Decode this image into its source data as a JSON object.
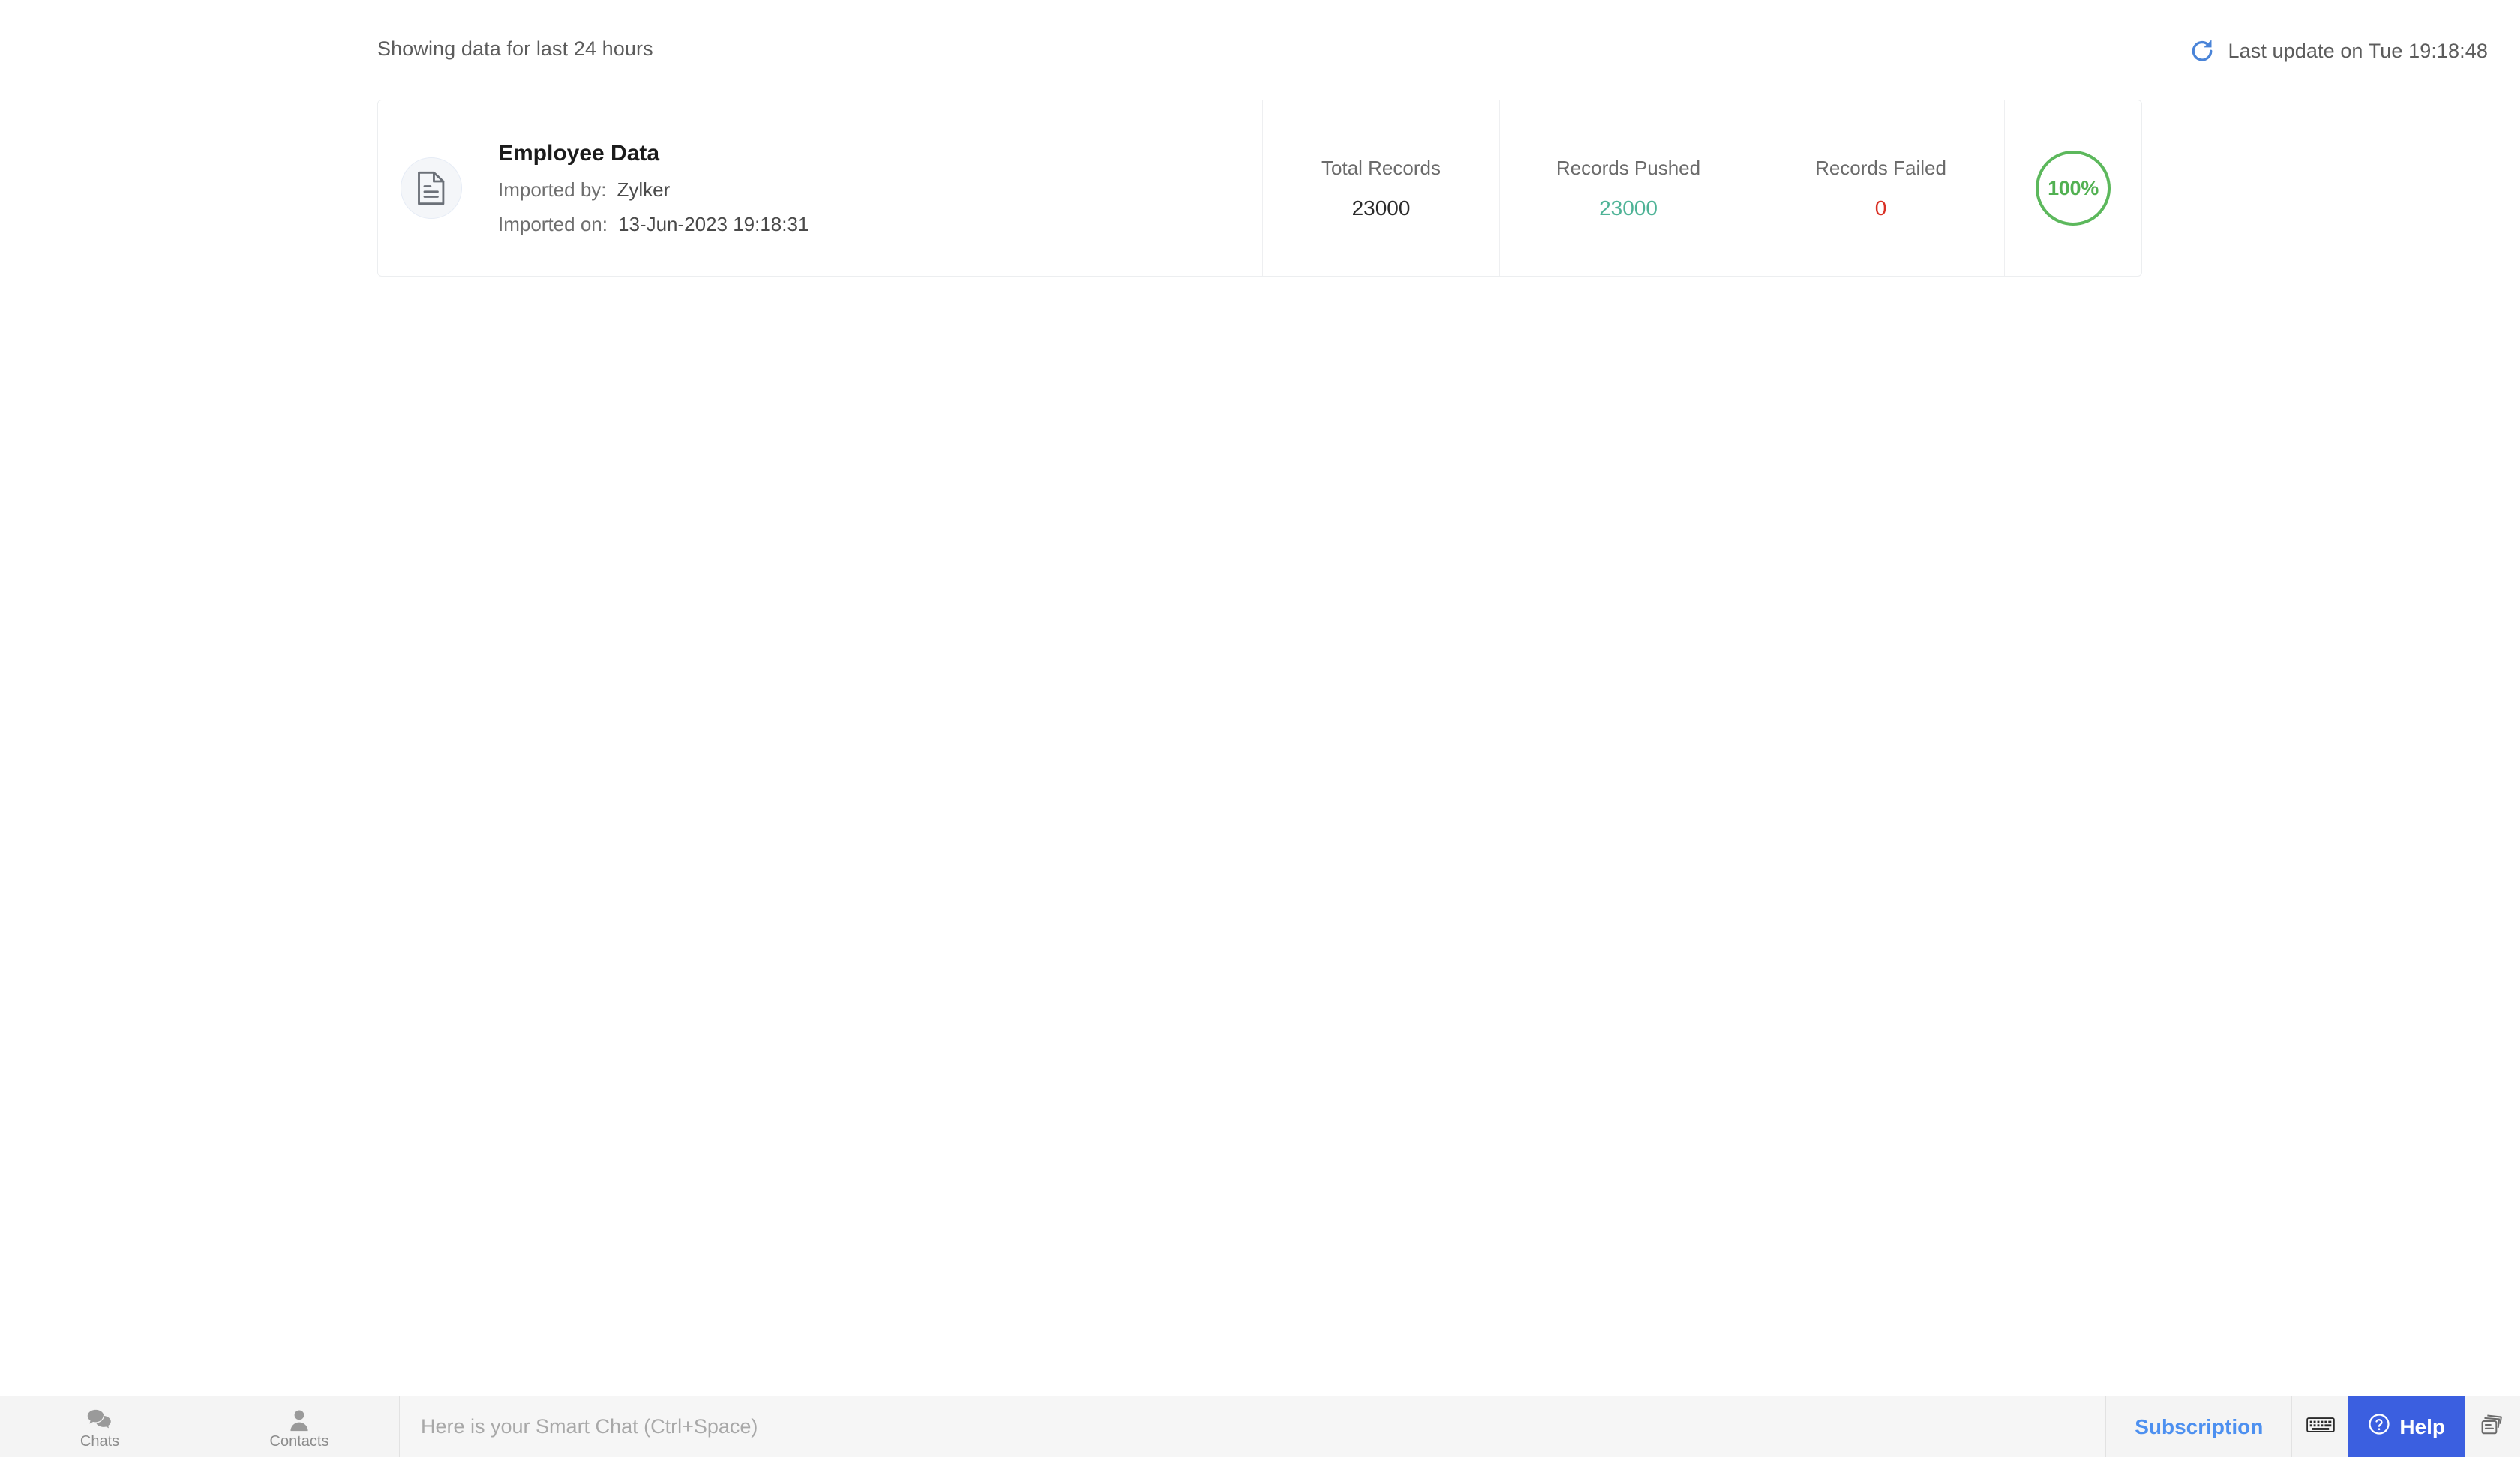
{
  "header": {
    "showing_data_text": "Showing data for last 24 hours",
    "refresh_icon": "refresh-icon",
    "last_update_text": "Last update on Tue 19:18:48"
  },
  "import_card": {
    "file_icon": "document-icon",
    "title": "Employee Data",
    "imported_by_label": "Imported by:",
    "imported_by_value": "Zylker",
    "imported_on_label": "Imported on:",
    "imported_on_value": "13-Jun-2023 19:18:31",
    "stats": [
      {
        "label": "Total Records",
        "value": "23000",
        "color": "#2b2b2b"
      },
      {
        "label": "Records Pushed",
        "value": "23000",
        "color": "#4eb396"
      },
      {
        "label": "Records Failed",
        "value": "0",
        "color": "#d93025"
      }
    ],
    "progress": {
      "percent_text": "100%",
      "percent_value": 100,
      "ring_color": "#5cb85c"
    }
  },
  "bottom_bar": {
    "tabs": [
      {
        "label": "Chats",
        "icon": "chat-bubbles-icon"
      },
      {
        "label": "Contacts",
        "icon": "person-icon"
      }
    ],
    "chat_input": {
      "placeholder": "Here is your Smart Chat (Ctrl+Space)",
      "value": ""
    },
    "subscription_label": "Subscription",
    "keyboard_icon": "keyboard-icon",
    "help_label": "Help",
    "help_icon": "question-circle-icon",
    "notes_icon": "notes-stack-icon",
    "accent_color": "#3b5fe0",
    "link_color": "#4d90f0"
  }
}
